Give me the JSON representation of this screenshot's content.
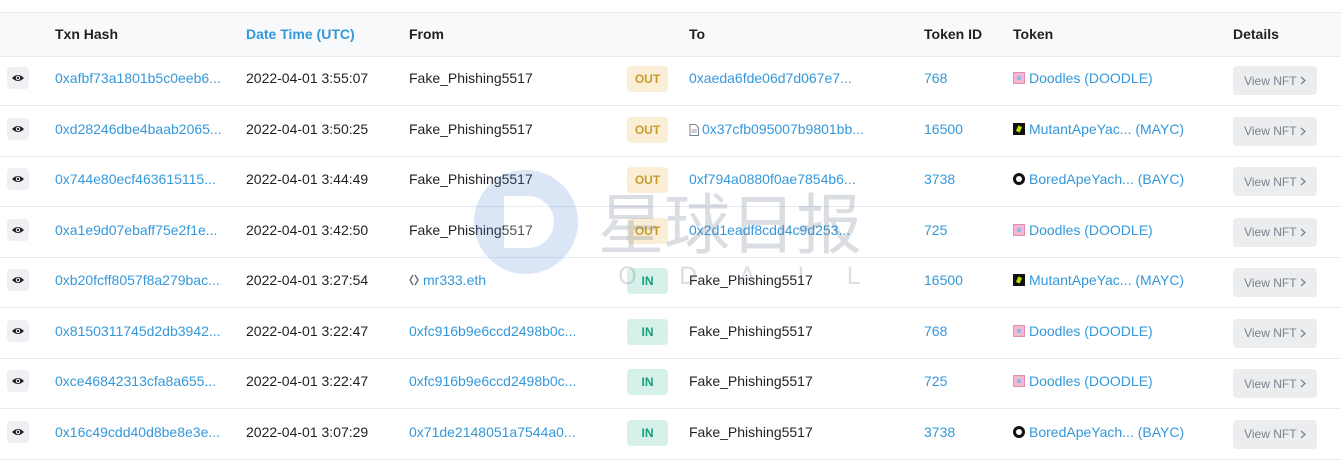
{
  "headers": {
    "txn_hash": "Txn Hash",
    "date_time": "Date Time (UTC)",
    "from": "From",
    "to": "To",
    "token_id": "Token ID",
    "token": "Token",
    "details": "Details"
  },
  "colors": {
    "link": "#3498db",
    "out_badge_bg": "#faeed6",
    "out_badge_text": "#c99c2b",
    "in_badge_bg": "#d6f1ea",
    "in_badge_text": "#15a07e"
  },
  "watermark": {
    "cn": "星球日报",
    "en": "ODAILY"
  },
  "rows": [
    {
      "hash": "0xafbf73a1801b5c0eeb6...",
      "date": "2022-04-01 3:55:07",
      "from": "Fake_Phishing5517",
      "direction": "OUT",
      "to": "0xaeda6fde06d7d067e7...",
      "token_id": "768",
      "token": "Doodles (DOODLE)",
      "token_icon": "doodles-icon",
      "details": "View NFT"
    },
    {
      "hash": "0xd28246dbe4baab2065...",
      "date": "2022-04-01 3:50:25",
      "from": "Fake_Phishing5517",
      "direction": "OUT",
      "to": "0x37cfb095007b9801bb...",
      "token_id": "16500",
      "token": "MutantApeYac... (MAYC)",
      "token_icon": "mayc-icon",
      "details": "View NFT"
    },
    {
      "hash": "0x744e80ecf463615115...",
      "date": "2022-04-01 3:44:49",
      "from": "Fake_Phishing5517",
      "direction": "OUT",
      "to": "0xf794a0880f0ae7854b6...",
      "token_id": "3738",
      "token": "BoredApeYach... (BAYC)",
      "token_icon": "bayc-icon",
      "details": "View NFT"
    },
    {
      "hash": "0xa1e9d07ebaff75e2f1e...",
      "date": "2022-04-01 3:42:50",
      "from": "Fake_Phishing5517",
      "direction": "OUT",
      "to": "0x2d1eadf8cdd4c9d253...",
      "token_id": "725",
      "token": "Doodles (DOODLE)",
      "token_icon": "doodles-icon",
      "details": "View NFT"
    },
    {
      "hash": "0xb20fcff8057f8a279bac...",
      "date": "2022-04-01 3:27:54",
      "from": "mr333.eth",
      "direction": "IN",
      "to": "Fake_Phishing5517",
      "token_id": "16500",
      "token": "MutantApeYac... (MAYC)",
      "token_icon": "mayc-icon",
      "details": "View NFT"
    },
    {
      "hash": "0x8150311745d2db3942...",
      "date": "2022-04-01 3:22:47",
      "from": "0xfc916b9e6ccd2498b0c...",
      "direction": "IN",
      "to": "Fake_Phishing5517",
      "token_id": "768",
      "token": "Doodles (DOODLE)",
      "token_icon": "doodles-icon",
      "details": "View NFT"
    },
    {
      "hash": "0xce46842313cfa8a655...",
      "date": "2022-04-01 3:22:47",
      "from": "0xfc916b9e6ccd2498b0c...",
      "direction": "IN",
      "to": "Fake_Phishing5517",
      "token_id": "725",
      "token": "Doodles (DOODLE)",
      "token_icon": "doodles-icon",
      "details": "View NFT"
    },
    {
      "hash": "0x16c49cdd40d8be8e3e...",
      "date": "2022-04-01 3:07:29",
      "from": "0x71de2148051a7544a0...",
      "direction": "IN",
      "to": "Fake_Phishing5517",
      "token_id": "3738",
      "token": "BoredApeYach... (BAYC)",
      "token_icon": "bayc-icon",
      "details": "View NFT"
    }
  ]
}
